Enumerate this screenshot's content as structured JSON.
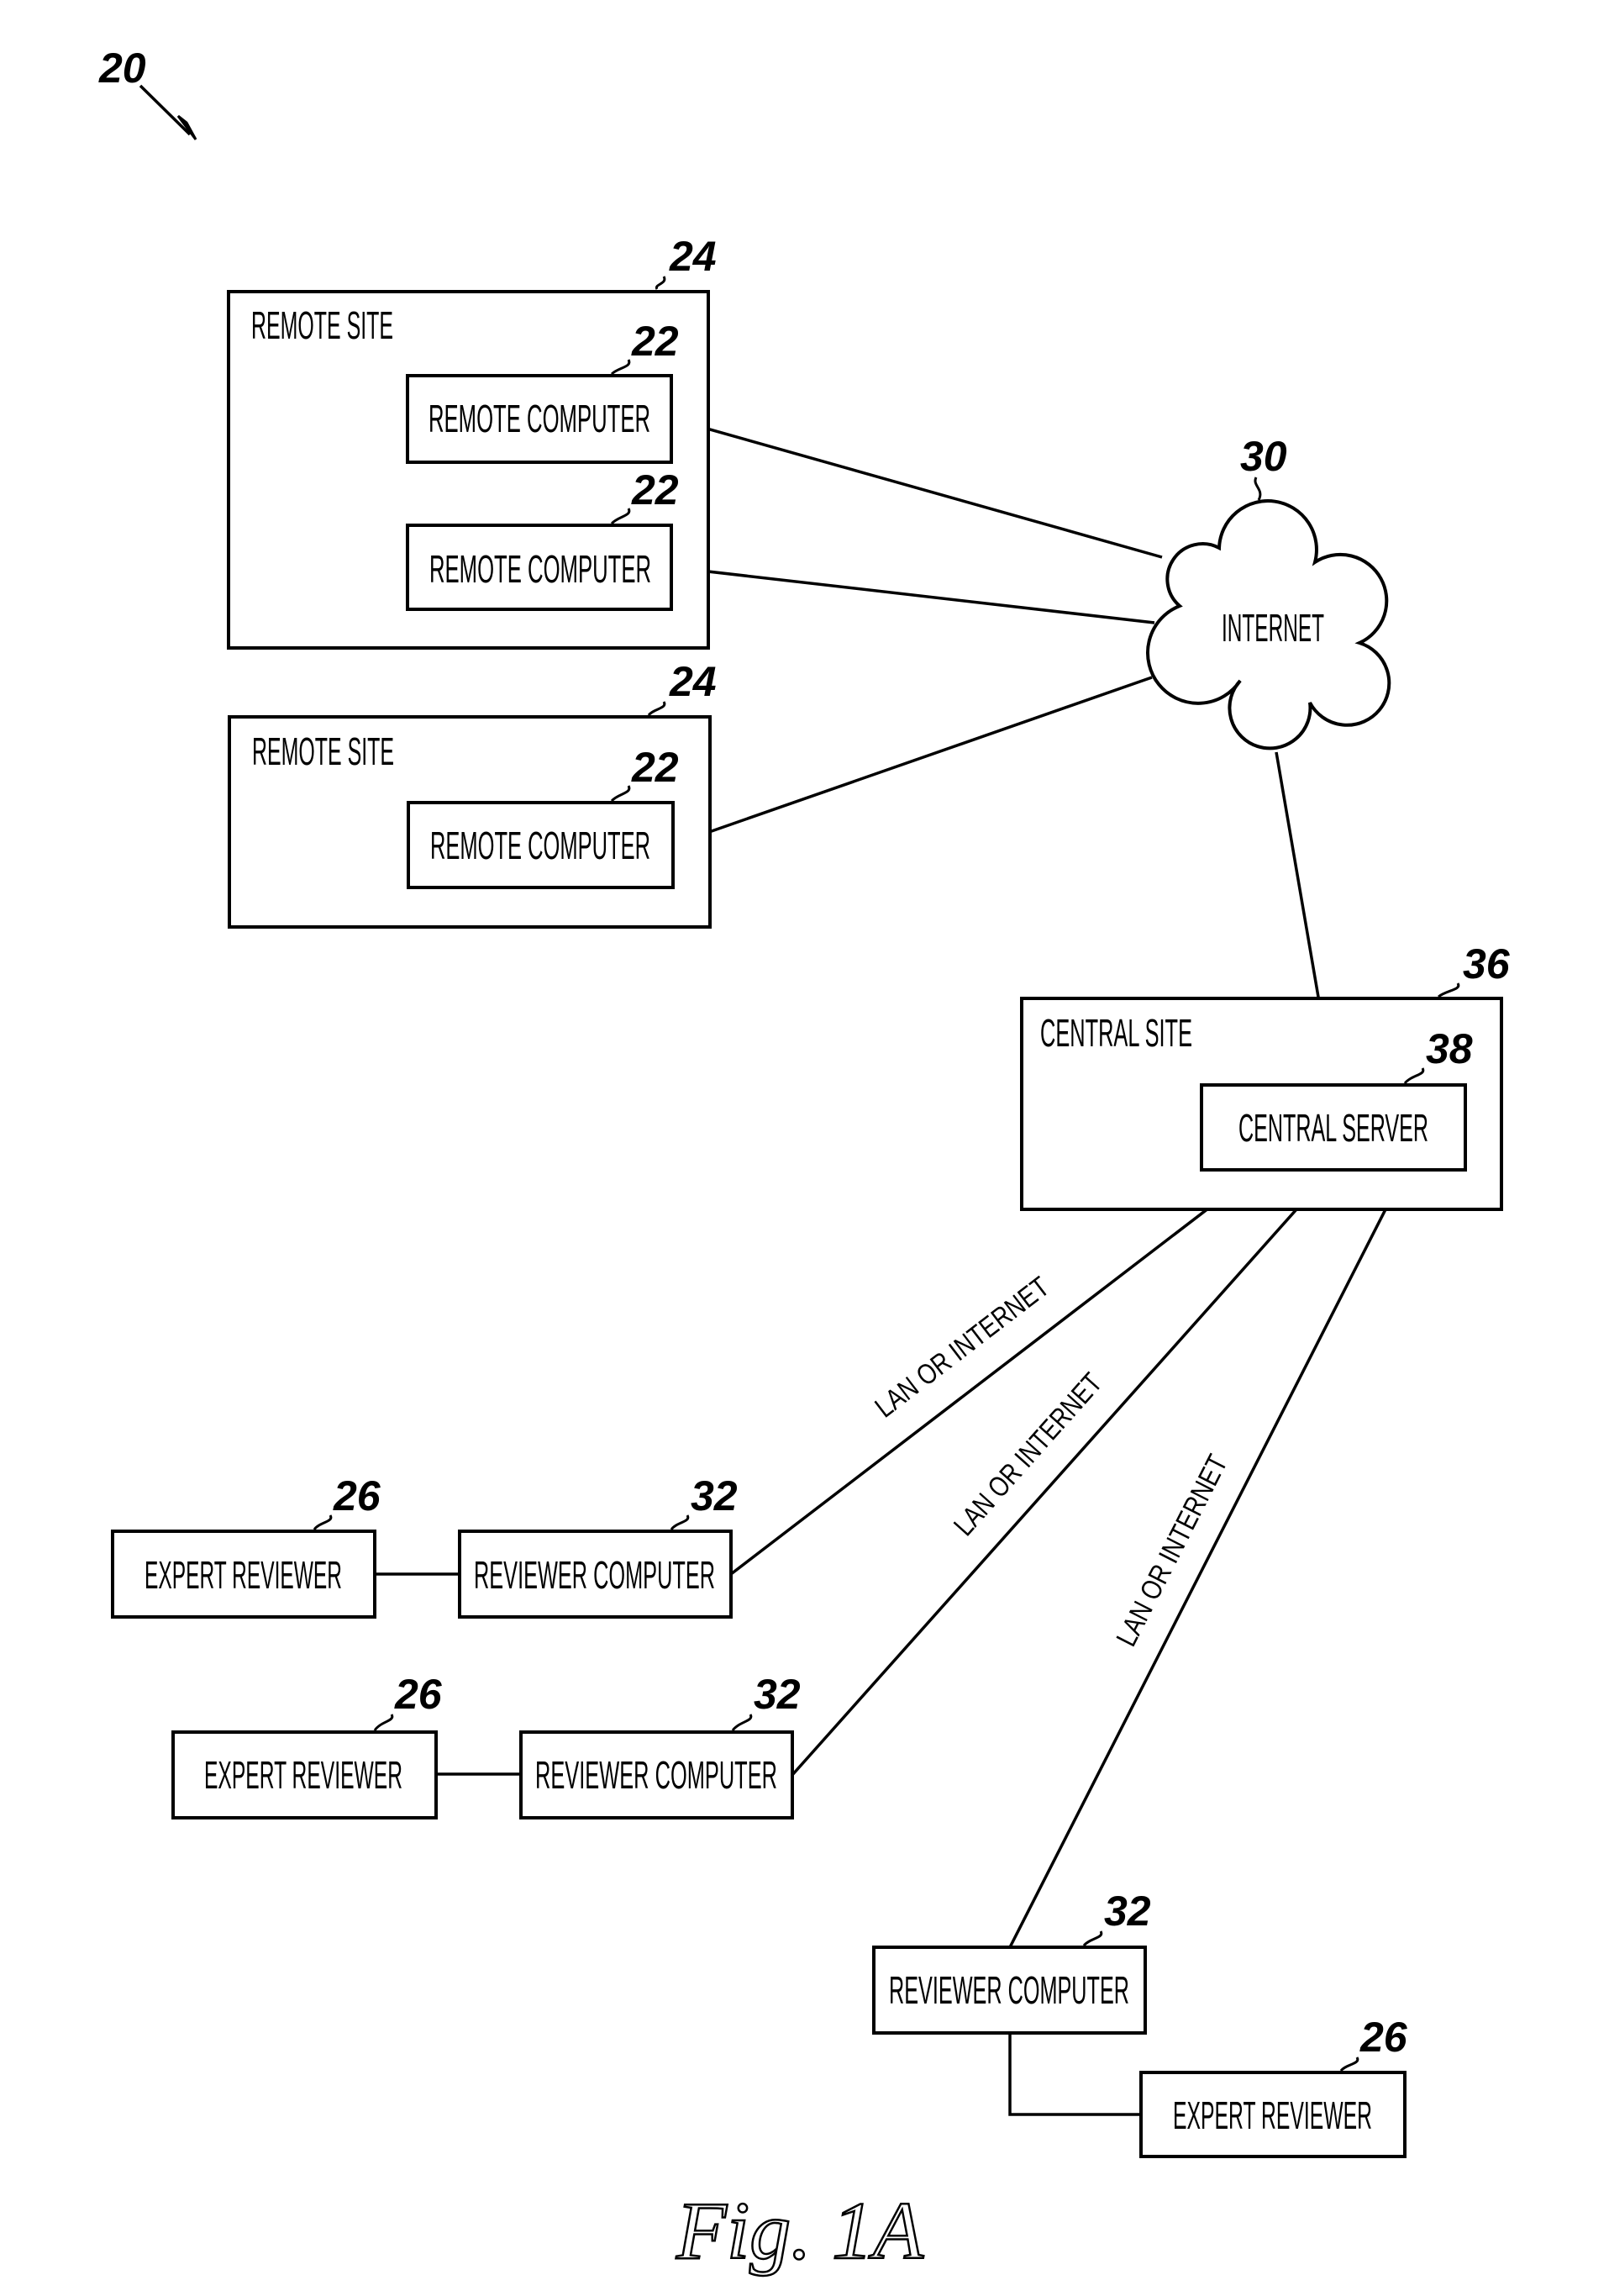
{
  "figure": {
    "caption": "Fig. 1A",
    "system_ref": "20",
    "colors": {
      "ink": "#000000",
      "paper": "#ffffff"
    }
  },
  "remote_sites": [
    {
      "ref": "24",
      "label": "REMOTE SITE",
      "computers": [
        {
          "ref": "22",
          "label": "REMOTE COMPUTER"
        },
        {
          "ref": "22",
          "label": "REMOTE COMPUTER"
        }
      ]
    },
    {
      "ref": "24",
      "label": "REMOTE SITE",
      "computers": [
        {
          "ref": "22",
          "label": "REMOTE COMPUTER"
        }
      ]
    }
  ],
  "internet": {
    "ref": "30",
    "label": "INTERNET"
  },
  "central_site": {
    "ref": "36",
    "label": "CENTRAL SITE",
    "server": {
      "ref": "38",
      "label": "CENTRAL SERVER"
    }
  },
  "links": {
    "lan_label": "LAN OR INTERNET"
  },
  "reviewers": [
    {
      "expert_ref": "26",
      "expert_label": "EXPERT REVIEWER",
      "computer_ref": "32",
      "computer_label": "REVIEWER COMPUTER",
      "link_label": "LAN OR INTERNET"
    },
    {
      "expert_ref": "26",
      "expert_label": "EXPERT REVIEWER",
      "computer_ref": "32",
      "computer_label": "REVIEWER COMPUTER",
      "link_label": "LAN OR INTERNET"
    },
    {
      "expert_ref": "26",
      "expert_label": "EXPERT REVIEWER",
      "computer_ref": "32",
      "computer_label": "REVIEWER COMPUTER",
      "link_label": "LAN OR INTERNET"
    }
  ]
}
